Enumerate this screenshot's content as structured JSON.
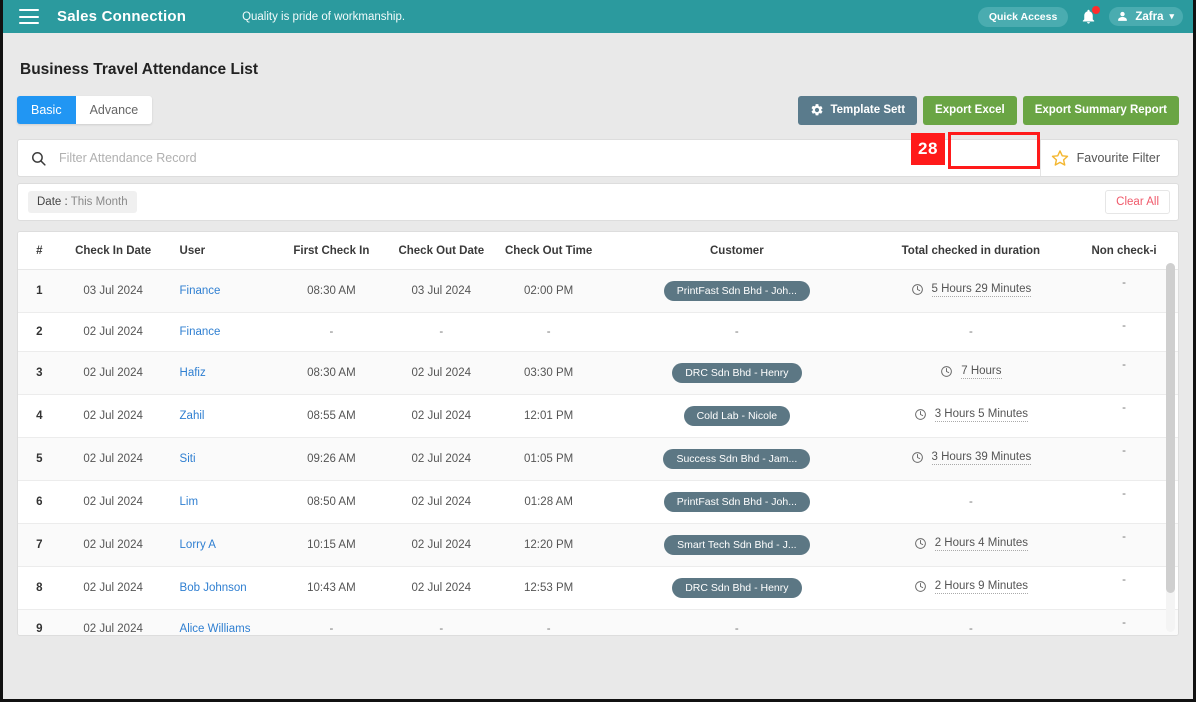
{
  "navbar": {
    "menu_icon": "hamburger-icon",
    "brand": "Sales Connection",
    "tagline": "Quality is pride of workmanship.",
    "quick_access_label": "Quick Access",
    "notification_icon": "bell-icon",
    "user_name": "Zafra",
    "user_caret": "⌄",
    "bg_color": "#2b9a9e"
  },
  "page": {
    "title": "Business Travel Attendance List"
  },
  "tabs": [
    {
      "label": "Basic",
      "active": true
    },
    {
      "label": "Advance",
      "active": false
    }
  ],
  "toolbar": {
    "template_settings_label": "Template Sett",
    "export_excel_label": "Export Excel",
    "export_summary_label": "Export Summary Report",
    "gear_icon": "gear-icon",
    "green_color": "#6aa544",
    "slate_color": "#5a7b8c"
  },
  "annotation": {
    "step_number": "28",
    "highlight_color": "#ff1a1a",
    "target": "Export Excel"
  },
  "search": {
    "icon": "search-icon",
    "placeholder": "Filter Attendance Record",
    "value": "",
    "favourite_filter_label": "Favourite Filter",
    "star_icon": "star-icon"
  },
  "filters": {
    "chips": [
      {
        "key": "Date",
        "separator": ":",
        "value": "This Month"
      }
    ],
    "clear_all_label": "Clear All",
    "clear_all_color": "#f05a6b"
  },
  "table": {
    "columns": [
      "#",
      "Check In Date",
      "User",
      "First Check In",
      "Check Out Date",
      "Check Out Time",
      "Customer",
      "Total checked in duration",
      "Non check-i"
    ],
    "clock_icon": "clock-icon",
    "badge_color": "#5c7784",
    "link_color": "#2f7fd1",
    "rows": [
      {
        "index": "1",
        "check_in_date": "03 Jul 2024",
        "user": "Finance",
        "first_check_in": "08:30 AM",
        "check_out_date": "03 Jul 2024",
        "check_out_time": "02:00 PM",
        "customer": "PrintFast Sdn Bhd - Joh...",
        "duration": "5 Hours 29 Minutes",
        "non_check_in": "-"
      },
      {
        "index": "2",
        "check_in_date": "02 Jul 2024",
        "user": "Finance",
        "first_check_in": "-",
        "check_out_date": "-",
        "check_out_time": "-",
        "customer": "-",
        "duration": "-",
        "non_check_in": "-"
      },
      {
        "index": "3",
        "check_in_date": "02 Jul 2024",
        "user": "Hafiz",
        "first_check_in": "08:30 AM",
        "check_out_date": "02 Jul 2024",
        "check_out_time": "03:30 PM",
        "customer": "DRC Sdn Bhd - Henry",
        "duration": "7 Hours",
        "non_check_in": "-"
      },
      {
        "index": "4",
        "check_in_date": "02 Jul 2024",
        "user": "Zahil",
        "first_check_in": "08:55 AM",
        "check_out_date": "02 Jul 2024",
        "check_out_time": "12:01 PM",
        "customer": "Cold Lab - Nicole",
        "duration": "3 Hours 5 Minutes",
        "non_check_in": "-"
      },
      {
        "index": "5",
        "check_in_date": "02 Jul 2024",
        "user": "Siti",
        "first_check_in": "09:26 AM",
        "check_out_date": "02 Jul 2024",
        "check_out_time": "01:05 PM",
        "customer": "Success Sdn Bhd - Jam...",
        "duration": "3 Hours 39 Minutes",
        "non_check_in": "-"
      },
      {
        "index": "6",
        "check_in_date": "02 Jul 2024",
        "user": "Lim",
        "first_check_in": "08:50 AM",
        "check_out_date": "02 Jul 2024",
        "check_out_time": "01:28 AM",
        "customer": "PrintFast Sdn Bhd - Joh...",
        "duration": "-",
        "non_check_in": "-"
      },
      {
        "index": "7",
        "check_in_date": "02 Jul 2024",
        "user": "Lorry A",
        "first_check_in": "10:15 AM",
        "check_out_date": "02 Jul 2024",
        "check_out_time": "12:20 PM",
        "customer": "Smart Tech Sdn Bhd - J...",
        "duration": "2 Hours 4 Minutes",
        "non_check_in": "-"
      },
      {
        "index": "8",
        "check_in_date": "02 Jul 2024",
        "user": "Bob Johnson",
        "first_check_in": "10:43 AM",
        "check_out_date": "02 Jul 2024",
        "check_out_time": "12:53 PM",
        "customer": "DRC Sdn Bhd - Henry",
        "duration": "2 Hours 9 Minutes",
        "non_check_in": "-"
      },
      {
        "index": "9",
        "check_in_date": "02 Jul 2024",
        "user": "Alice Williams",
        "first_check_in": "-",
        "check_out_date": "-",
        "check_out_time": "-",
        "customer": "-",
        "duration": "-",
        "non_check_in": "-"
      }
    ]
  }
}
